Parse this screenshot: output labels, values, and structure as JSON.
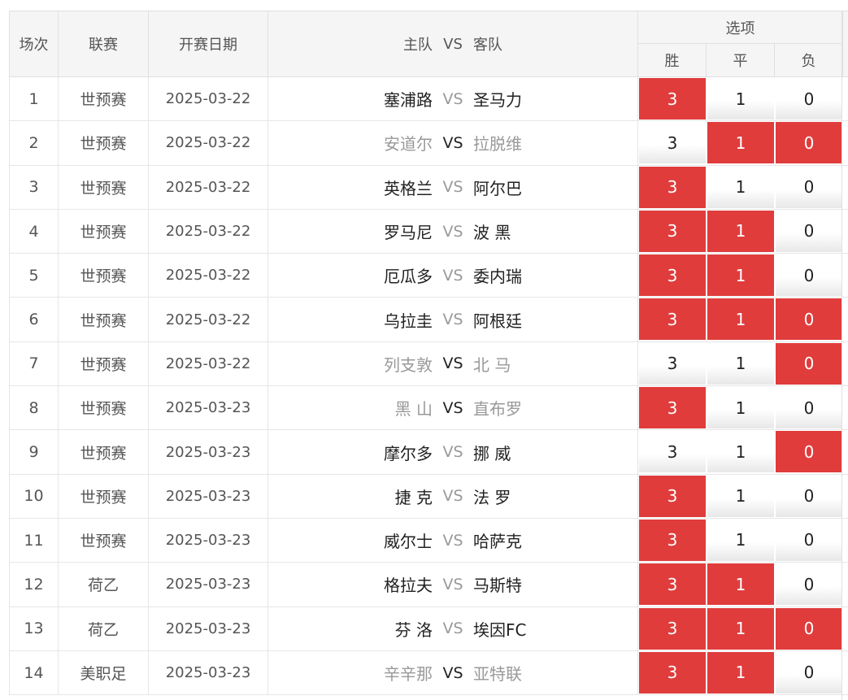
{
  "header": {
    "round": "场次",
    "league": "联赛",
    "date": "开赛日期",
    "home": "主队",
    "vs": "VS",
    "away": "客队",
    "options_title": "选项",
    "options": [
      "胜",
      "平",
      "负"
    ]
  },
  "rows": [
    {
      "round": "1",
      "league": "世预赛",
      "date": "2025-03-22",
      "home": "塞浦路",
      "vs": "VS",
      "away": "圣马力",
      "win": "3",
      "draw": "1",
      "lose": "0"
    },
    {
      "round": "2",
      "league": "世预赛",
      "date": "2025-03-22",
      "home": "安道尔",
      "vs": "VS",
      "away": "拉脱维",
      "win": "3",
      "draw": "1",
      "lose": "0"
    },
    {
      "round": "3",
      "league": "世预赛",
      "date": "2025-03-22",
      "home": "英格兰",
      "vs": "VS",
      "away": "阿尔巴",
      "win": "3",
      "draw": "1",
      "lose": "0"
    },
    {
      "round": "4",
      "league": "世预赛",
      "date": "2025-03-22",
      "home": "罗马尼",
      "vs": "VS",
      "away": "波 黑",
      "win": "3",
      "draw": "1",
      "lose": "0"
    },
    {
      "round": "5",
      "league": "世预赛",
      "date": "2025-03-22",
      "home": "厄瓜多",
      "vs": "VS",
      "away": "委内瑞",
      "win": "3",
      "draw": "1",
      "lose": "0"
    },
    {
      "round": "6",
      "league": "世预赛",
      "date": "2025-03-22",
      "home": "乌拉圭",
      "vs": "VS",
      "away": "阿根廷",
      "win": "3",
      "draw": "1",
      "lose": "0"
    },
    {
      "round": "7",
      "league": "世预赛",
      "date": "2025-03-22",
      "home": "列支敦",
      "vs": "VS",
      "away": "北 马",
      "win": "3",
      "draw": "1",
      "lose": "0"
    },
    {
      "round": "8",
      "league": "世预赛",
      "date": "2025-03-23",
      "home": "黑 山",
      "vs": "VS",
      "away": "直布罗",
      "win": "3",
      "draw": "1",
      "lose": "0"
    },
    {
      "round": "9",
      "league": "世预赛",
      "date": "2025-03-23",
      "home": "摩尔多",
      "vs": "VS",
      "away": "挪 威",
      "win": "3",
      "draw": "1",
      "lose": "0"
    },
    {
      "round": "10",
      "league": "世预赛",
      "date": "2025-03-23",
      "home": "捷 克",
      "vs": "VS",
      "away": "法 罗",
      "win": "3",
      "draw": "1",
      "lose": "0"
    },
    {
      "round": "11",
      "league": "世预赛",
      "date": "2025-03-23",
      "home": "威尔士",
      "vs": "VS",
      "away": "哈萨克",
      "win": "3",
      "draw": "1",
      "lose": "0"
    },
    {
      "round": "12",
      "league": "荷乙",
      "date": "2025-03-23",
      "home": "格拉夫",
      "vs": "VS",
      "away": "马斯特",
      "win": "3",
      "draw": "1",
      "lose": "0"
    },
    {
      "round": "13",
      "league": "荷乙",
      "date": "2025-03-23",
      "home": "芬 洛",
      "vs": "VS",
      "away": "埃因FC",
      "win": "3",
      "draw": "1",
      "lose": "0"
    },
    {
      "round": "14",
      "league": "美职足",
      "date": "2025-03-23",
      "home": "辛辛那",
      "vs": "VS",
      "away": "亚特联",
      "win": "3",
      "draw": "1",
      "lose": "0"
    }
  ],
  "colors": {
    "selected": "#e03c3c",
    "muted_text": "#999999",
    "strong_text": "#222222"
  }
}
